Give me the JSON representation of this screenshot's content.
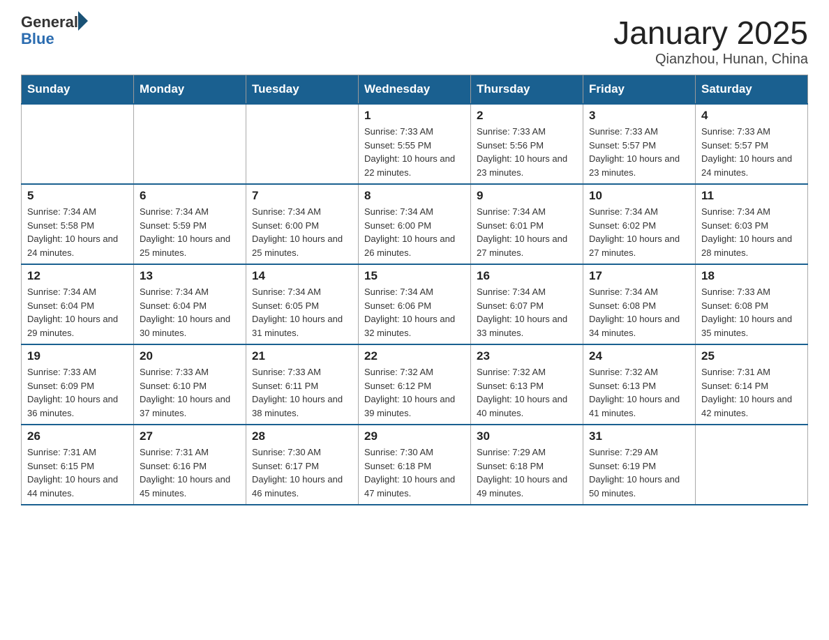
{
  "header": {
    "logo_general": "General",
    "logo_blue": "Blue",
    "title": "January 2025",
    "subtitle": "Qianzhou, Hunan, China"
  },
  "days_of_week": [
    "Sunday",
    "Monday",
    "Tuesday",
    "Wednesday",
    "Thursday",
    "Friday",
    "Saturday"
  ],
  "weeks": [
    [
      {
        "day": "",
        "info": ""
      },
      {
        "day": "",
        "info": ""
      },
      {
        "day": "",
        "info": ""
      },
      {
        "day": "1",
        "info": "Sunrise: 7:33 AM\nSunset: 5:55 PM\nDaylight: 10 hours\nand 22 minutes."
      },
      {
        "day": "2",
        "info": "Sunrise: 7:33 AM\nSunset: 5:56 PM\nDaylight: 10 hours\nand 23 minutes."
      },
      {
        "day": "3",
        "info": "Sunrise: 7:33 AM\nSunset: 5:57 PM\nDaylight: 10 hours\nand 23 minutes."
      },
      {
        "day": "4",
        "info": "Sunrise: 7:33 AM\nSunset: 5:57 PM\nDaylight: 10 hours\nand 24 minutes."
      }
    ],
    [
      {
        "day": "5",
        "info": "Sunrise: 7:34 AM\nSunset: 5:58 PM\nDaylight: 10 hours\nand 24 minutes."
      },
      {
        "day": "6",
        "info": "Sunrise: 7:34 AM\nSunset: 5:59 PM\nDaylight: 10 hours\nand 25 minutes."
      },
      {
        "day": "7",
        "info": "Sunrise: 7:34 AM\nSunset: 6:00 PM\nDaylight: 10 hours\nand 25 minutes."
      },
      {
        "day": "8",
        "info": "Sunrise: 7:34 AM\nSunset: 6:00 PM\nDaylight: 10 hours\nand 26 minutes."
      },
      {
        "day": "9",
        "info": "Sunrise: 7:34 AM\nSunset: 6:01 PM\nDaylight: 10 hours\nand 27 minutes."
      },
      {
        "day": "10",
        "info": "Sunrise: 7:34 AM\nSunset: 6:02 PM\nDaylight: 10 hours\nand 27 minutes."
      },
      {
        "day": "11",
        "info": "Sunrise: 7:34 AM\nSunset: 6:03 PM\nDaylight: 10 hours\nand 28 minutes."
      }
    ],
    [
      {
        "day": "12",
        "info": "Sunrise: 7:34 AM\nSunset: 6:04 PM\nDaylight: 10 hours\nand 29 minutes."
      },
      {
        "day": "13",
        "info": "Sunrise: 7:34 AM\nSunset: 6:04 PM\nDaylight: 10 hours\nand 30 minutes."
      },
      {
        "day": "14",
        "info": "Sunrise: 7:34 AM\nSunset: 6:05 PM\nDaylight: 10 hours\nand 31 minutes."
      },
      {
        "day": "15",
        "info": "Sunrise: 7:34 AM\nSunset: 6:06 PM\nDaylight: 10 hours\nand 32 minutes."
      },
      {
        "day": "16",
        "info": "Sunrise: 7:34 AM\nSunset: 6:07 PM\nDaylight: 10 hours\nand 33 minutes."
      },
      {
        "day": "17",
        "info": "Sunrise: 7:34 AM\nSunset: 6:08 PM\nDaylight: 10 hours\nand 34 minutes."
      },
      {
        "day": "18",
        "info": "Sunrise: 7:33 AM\nSunset: 6:08 PM\nDaylight: 10 hours\nand 35 minutes."
      }
    ],
    [
      {
        "day": "19",
        "info": "Sunrise: 7:33 AM\nSunset: 6:09 PM\nDaylight: 10 hours\nand 36 minutes."
      },
      {
        "day": "20",
        "info": "Sunrise: 7:33 AM\nSunset: 6:10 PM\nDaylight: 10 hours\nand 37 minutes."
      },
      {
        "day": "21",
        "info": "Sunrise: 7:33 AM\nSunset: 6:11 PM\nDaylight: 10 hours\nand 38 minutes."
      },
      {
        "day": "22",
        "info": "Sunrise: 7:32 AM\nSunset: 6:12 PM\nDaylight: 10 hours\nand 39 minutes."
      },
      {
        "day": "23",
        "info": "Sunrise: 7:32 AM\nSunset: 6:13 PM\nDaylight: 10 hours\nand 40 minutes."
      },
      {
        "day": "24",
        "info": "Sunrise: 7:32 AM\nSunset: 6:13 PM\nDaylight: 10 hours\nand 41 minutes."
      },
      {
        "day": "25",
        "info": "Sunrise: 7:31 AM\nSunset: 6:14 PM\nDaylight: 10 hours\nand 42 minutes."
      }
    ],
    [
      {
        "day": "26",
        "info": "Sunrise: 7:31 AM\nSunset: 6:15 PM\nDaylight: 10 hours\nand 44 minutes."
      },
      {
        "day": "27",
        "info": "Sunrise: 7:31 AM\nSunset: 6:16 PM\nDaylight: 10 hours\nand 45 minutes."
      },
      {
        "day": "28",
        "info": "Sunrise: 7:30 AM\nSunset: 6:17 PM\nDaylight: 10 hours\nand 46 minutes."
      },
      {
        "day": "29",
        "info": "Sunrise: 7:30 AM\nSunset: 6:18 PM\nDaylight: 10 hours\nand 47 minutes."
      },
      {
        "day": "30",
        "info": "Sunrise: 7:29 AM\nSunset: 6:18 PM\nDaylight: 10 hours\nand 49 minutes."
      },
      {
        "day": "31",
        "info": "Sunrise: 7:29 AM\nSunset: 6:19 PM\nDaylight: 10 hours\nand 50 minutes."
      },
      {
        "day": "",
        "info": ""
      }
    ]
  ]
}
